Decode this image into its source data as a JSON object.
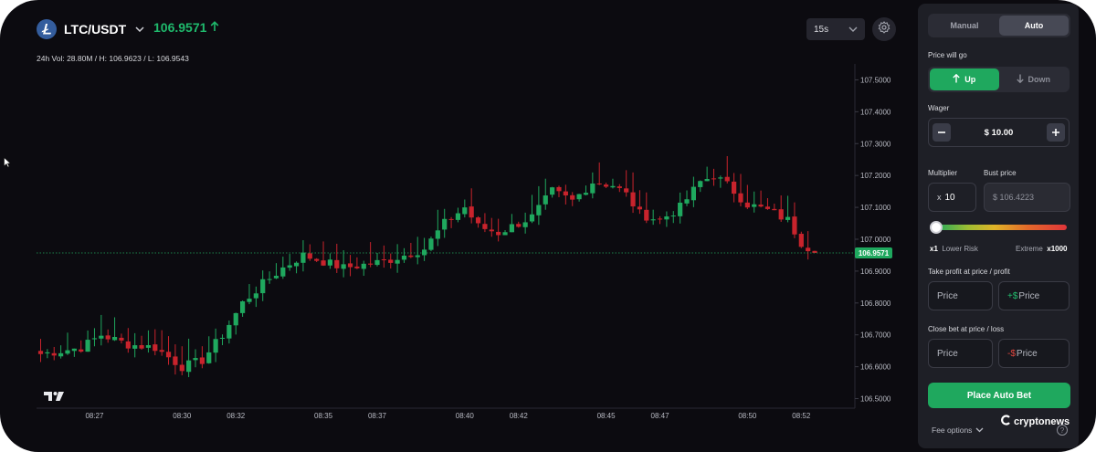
{
  "header": {
    "pair": "LTC/USDT",
    "price": "106.9571",
    "stats": "24h Vol: 28.80M / H: 106.9623 / L: 106.9543",
    "interval": "15s"
  },
  "chart_data": {
    "type": "candlestick",
    "price_scale": {
      "ylim": [
        106.47,
        107.55
      ],
      "ticks": [
        "107.5000",
        "107.4000",
        "107.3000",
        "107.2000",
        "107.1000",
        "107.0000",
        "106.9000",
        "106.8000",
        "106.7000",
        "106.6000",
        "106.5000"
      ],
      "tick_values": [
        107.5,
        107.4,
        107.3,
        107.2,
        107.1,
        107.0,
        106.9,
        106.8,
        106.7,
        106.6,
        106.5
      ]
    },
    "time_scale": {
      "labels": [
        "08:27",
        "08:30",
        "08:32",
        "08:35",
        "08:37",
        "08:40",
        "08:42",
        "08:45",
        "08:47",
        "08:50",
        "08:52"
      ],
      "label_index": [
        8,
        21,
        29,
        42,
        50,
        63,
        71,
        84,
        92,
        105,
        113
      ]
    },
    "current_price": "106.9571",
    "current_value": 106.9571,
    "close_path": [
      [
        0,
        106.64
      ],
      [
        6,
        106.66
      ],
      [
        9,
        106.7
      ],
      [
        13,
        106.67
      ],
      [
        17,
        106.66
      ],
      [
        21,
        106.6
      ],
      [
        24,
        106.62
      ],
      [
        27,
        106.7
      ],
      [
        30,
        106.8
      ],
      [
        33,
        106.86
      ],
      [
        36,
        106.91
      ],
      [
        39,
        106.95
      ],
      [
        42,
        106.93
      ],
      [
        45,
        106.91
      ],
      [
        48,
        106.92
      ],
      [
        51,
        106.93
      ],
      [
        54,
        106.95
      ],
      [
        57,
        106.97
      ],
      [
        60,
        107.05
      ],
      [
        63,
        107.1
      ],
      [
        65,
        107.04
      ],
      [
        68,
        107.02
      ],
      [
        71,
        107.05
      ],
      [
        73,
        107.07
      ],
      [
        76,
        107.15
      ],
      [
        79,
        107.12
      ],
      [
        82,
        107.18
      ],
      [
        85,
        107.17
      ],
      [
        87,
        107.14
      ],
      [
        89,
        107.08
      ],
      [
        92,
        107.06
      ],
      [
        95,
        107.1
      ],
      [
        98,
        107.18
      ],
      [
        100,
        107.2
      ],
      [
        102,
        107.17
      ],
      [
        105,
        107.11
      ],
      [
        108,
        107.09
      ],
      [
        111,
        107.06
      ],
      [
        113,
        106.99
      ],
      [
        115,
        106.96
      ]
    ]
  },
  "panel": {
    "mode_tabs": [
      "Manual",
      "Auto"
    ],
    "active_mode": "Auto",
    "direction_label": "Price will go",
    "up_label": "Up",
    "down_label": "Down",
    "wager_label": "Wager",
    "wager_value": "$ 10.00",
    "multiplier_label": "Multiplier",
    "multiplier_prefix": "x",
    "multiplier_value": "10",
    "bust_label": "Bust price",
    "bust_value": "$ 106.4223",
    "risk_min": "x1",
    "risk_min_label": "Lower Risk",
    "risk_max_label": "Extreme",
    "risk_max": "x1000",
    "risk_level": 0.0,
    "tp_label": "Take profit at price / profit",
    "tp_price_placeholder": "Price",
    "tp_profit_prefix": "+$",
    "tp_profit_placeholder": "Price",
    "sl_label": "Close bet at price / loss",
    "sl_price_placeholder": "Price",
    "sl_loss_prefix": "-$",
    "sl_loss_placeholder": "Price",
    "place_button": "Place Auto Bet",
    "fee_options": "Fee options",
    "brand": "cryptonews"
  },
  "colors": {
    "up": "#1fa85e",
    "down": "#c8232c",
    "background": "#0c0b10",
    "panel": "#1e1f26"
  }
}
